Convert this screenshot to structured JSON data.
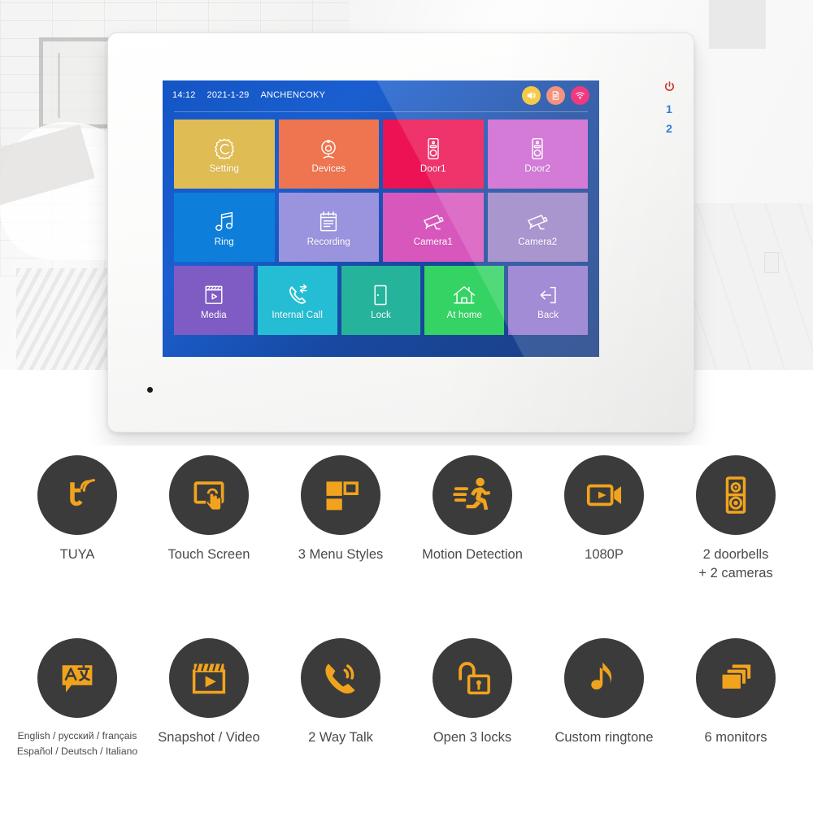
{
  "device": {
    "brand_watermark": "ANCHENCOKY",
    "side_indicators": {
      "power_icon": "power-icon",
      "numbers": [
        "1",
        "2"
      ]
    },
    "microphone": "microphone-hole"
  },
  "screen": {
    "statusbar": {
      "time": "14:12",
      "date": "2021-1-29",
      "brand": "ANCHENCOKY",
      "icons": [
        {
          "name": "speaker-icon",
          "color": "#f2c22a"
        },
        {
          "name": "document-icon",
          "color": "#f0806a"
        },
        {
          "name": "wifi-icon",
          "color": "#ec1a6e"
        }
      ]
    },
    "menu_rows": [
      [
        {
          "label": "Setting",
          "icon": "gear-icon",
          "color": "#e0bc55"
        },
        {
          "label": "Devices",
          "icon": "webcam-icon",
          "color": "#ef7550"
        },
        {
          "label": "Door1",
          "icon": "doorbell-icon",
          "color": "#ec1253"
        },
        {
          "label": "Door2",
          "icon": "doorbell-icon",
          "color": "#cc65d0"
        }
      ],
      [
        {
          "label": "Ring",
          "icon": "music-note-icon",
          "color": "#0d7fdb"
        },
        {
          "label": "Recording",
          "icon": "document-lines-icon",
          "color": "#9a93dd"
        },
        {
          "label": "Camera1",
          "icon": "cctv-camera-icon",
          "color": "#d857bd"
        },
        {
          "label": "Camera2",
          "icon": "cctv-camera-icon",
          "color": "#9b85c6"
        }
      ],
      [
        {
          "label": "Media",
          "icon": "clapperboard-icon",
          "color": "#7f5cc4"
        },
        {
          "label": "Internal Call",
          "icon": "phone-transfer-icon",
          "color": "#25bdd4"
        },
        {
          "label": "Lock",
          "icon": "door-icon",
          "color": "#25b49b"
        },
        {
          "label": "At home",
          "icon": "house-icon",
          "color": "#34d364"
        },
        {
          "label": "Back",
          "icon": "exit-arrow-icon",
          "color": "#9479cf"
        }
      ]
    ]
  },
  "features": {
    "row1": [
      {
        "label": "TUYA",
        "icon": "tuya-logo-icon"
      },
      {
        "label": "Touch Screen",
        "icon": "touch-screen-icon"
      },
      {
        "label": "3 Menu Styles",
        "icon": "menu-styles-icon"
      },
      {
        "label": "Motion Detection",
        "icon": "running-person-icon"
      },
      {
        "label": "1080P",
        "icon": "video-camera-icon"
      },
      {
        "label": "2 doorbells\n+ 2 cameras",
        "icon": "doorbell-panel-icon"
      }
    ],
    "row2": [
      {
        "label": "English / русский / français\nEspañol /  Deutsch / Italiano",
        "icon": "translate-icon",
        "small": true
      },
      {
        "label": "Snapshot / Video",
        "icon": "film-play-icon"
      },
      {
        "label": "2 Way Talk",
        "icon": "phone-talk-icon"
      },
      {
        "label": "Open 3 locks",
        "icon": "unlock-icon"
      },
      {
        "label": "Custom ringtone",
        "icon": "music-note-solid-icon"
      },
      {
        "label": "6 monitors",
        "icon": "multi-screens-icon"
      }
    ]
  },
  "colors": {
    "accent_orange": "#f2a31d",
    "circle_dark": "#3b3b3b",
    "label_gray": "#4a4a4a"
  }
}
